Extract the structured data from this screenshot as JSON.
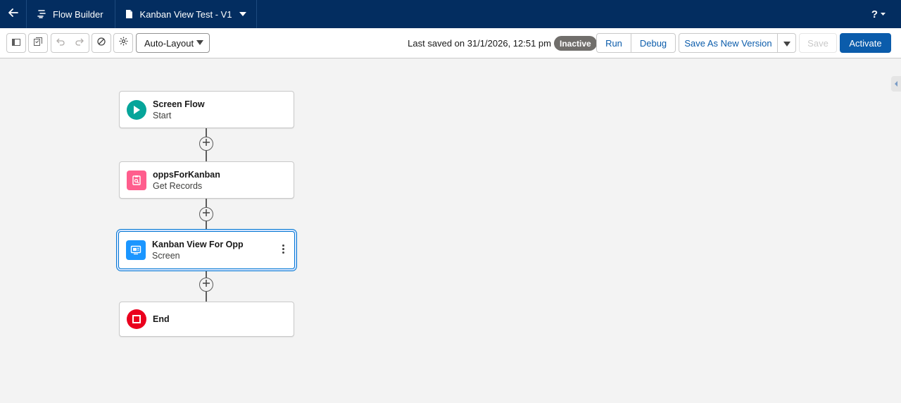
{
  "header": {
    "app_name": "Flow Builder",
    "flow_name": "Kanban View Test - V1",
    "help_label": "?"
  },
  "toolbar": {
    "layout_select": "Auto-Layout",
    "last_saved": "Last saved on 31/1/2026, 12:51 pm",
    "status_badge": "Inactive",
    "run_label": "Run",
    "debug_label": "Debug",
    "save_as_new_version_label": "Save As New Version",
    "save_label": "Save",
    "activate_label": "Activate"
  },
  "canvas": {
    "nodes": [
      {
        "title": "Screen Flow",
        "subtitle": "Start",
        "icon": "play-icon",
        "color": "#06a59a"
      },
      {
        "title": "oppsForKanban",
        "subtitle": "Get Records",
        "icon": "get-records-icon",
        "color": "#ff5d8d"
      },
      {
        "title": "Kanban View For Opp",
        "subtitle": "Screen",
        "icon": "screen-icon",
        "color": "#1b96ff"
      },
      {
        "title": "End",
        "subtitle": "",
        "icon": "stop-icon",
        "color": "#ea001e"
      }
    ]
  },
  "colors": {
    "header_bg": "#032d60",
    "brand_button": "#0b5cab",
    "canvas_bg": "#f3f3f3"
  }
}
